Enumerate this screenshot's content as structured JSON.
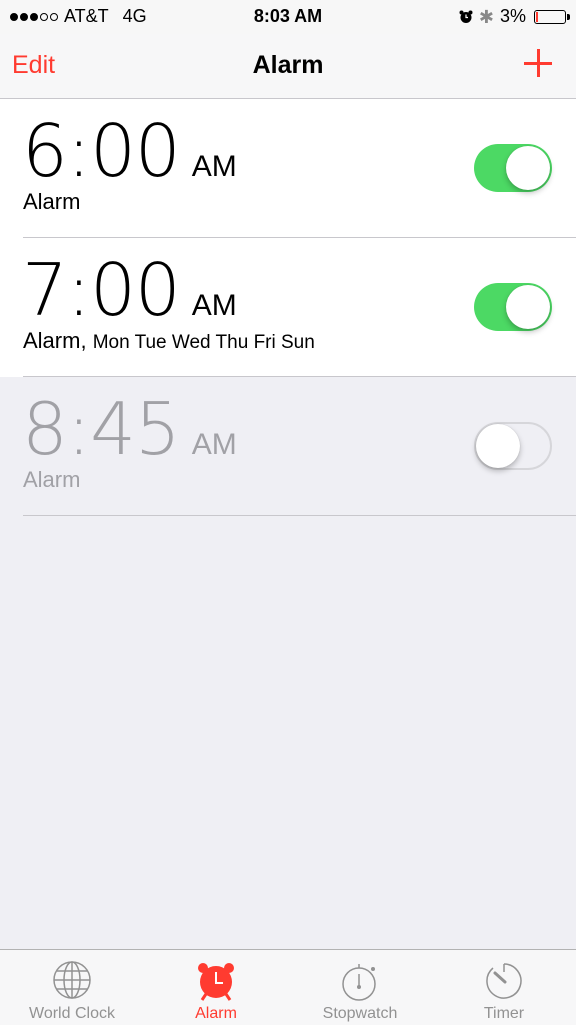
{
  "status_bar": {
    "signal_filled": 3,
    "signal_total": 5,
    "carrier": "AT&T",
    "network": "4G",
    "time": "8:03 AM",
    "battery_percent": "3%",
    "icons": [
      "alarm-clock-icon",
      "bluetooth-icon",
      "battery-icon"
    ]
  },
  "nav": {
    "edit_label": "Edit",
    "title": "Alarm",
    "add_icon": "plus-icon"
  },
  "alarms": [
    {
      "time": "6:00",
      "ampm": "AM",
      "label": "Alarm",
      "days": "",
      "enabled": true
    },
    {
      "time": "7:00",
      "ampm": "AM",
      "label": "Alarm,",
      "days": "Mon Tue Wed Thu Fri Sun",
      "enabled": true
    },
    {
      "time": "8:45",
      "ampm": "AM",
      "label": "Alarm",
      "days": "",
      "enabled": false
    }
  ],
  "tabs": [
    {
      "label": "World Clock",
      "icon": "globe-icon",
      "active": false
    },
    {
      "label": "Alarm",
      "icon": "alarm-clock-icon",
      "active": true
    },
    {
      "label": "Stopwatch",
      "icon": "stopwatch-icon",
      "active": false
    },
    {
      "label": "Timer",
      "icon": "timer-icon",
      "active": false
    }
  ],
  "colors": {
    "accent": "#ff3b30",
    "toggle_on": "#4cd964",
    "background": "#efeff4",
    "inactive": "#929292"
  }
}
